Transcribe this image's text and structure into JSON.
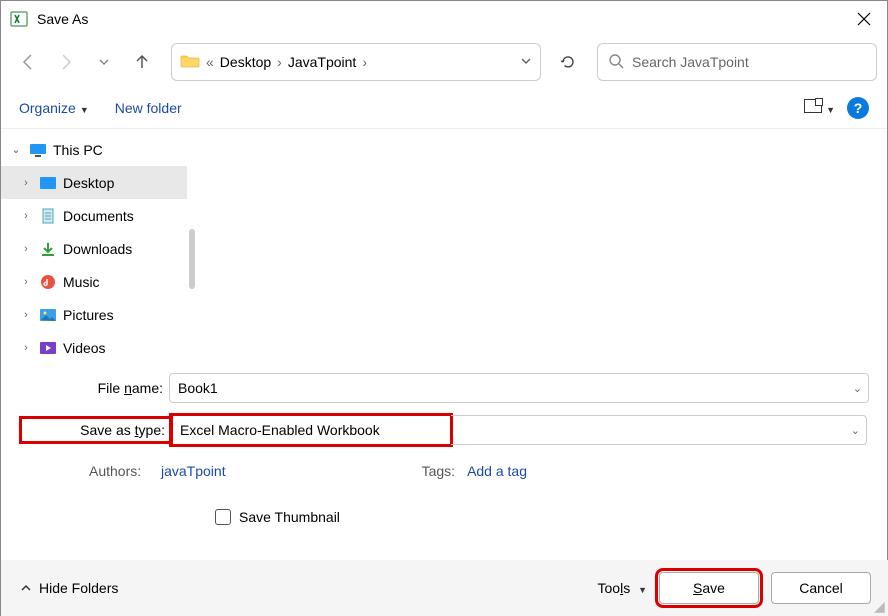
{
  "window": {
    "title": "Save As"
  },
  "breadcrumb": {
    "seg1": "Desktop",
    "seg2": "JavaTpoint"
  },
  "search": {
    "placeholder": "Search JavaTpoint"
  },
  "toolbar": {
    "organize": "Organize",
    "newfolder": "New folder"
  },
  "tree": {
    "root": "This PC",
    "items": [
      {
        "label": "Desktop"
      },
      {
        "label": "Documents"
      },
      {
        "label": "Downloads"
      },
      {
        "label": "Music"
      },
      {
        "label": "Pictures"
      },
      {
        "label": "Videos"
      }
    ]
  },
  "form": {
    "filename_label_pre": "File ",
    "filename_label_u": "n",
    "filename_label_post": "ame:",
    "filename_value": "Book1",
    "savetype_label_pre": "Save as ",
    "savetype_label_u": "t",
    "savetype_label_post": "ype:",
    "savetype_value": "Excel Macro-Enabled Workbook",
    "authors_label": "Authors:",
    "authors_value": "javaTpoint",
    "tags_label": "Tags:",
    "tags_value": "Add a tag",
    "thumbnail": "Save Thumbnail"
  },
  "footer": {
    "hide": "Hide Folders",
    "tools_pre": "Too",
    "tools_u": "l",
    "tools_post": "s",
    "save_u": "S",
    "save_post": "ave",
    "cancel": "Cancel"
  }
}
